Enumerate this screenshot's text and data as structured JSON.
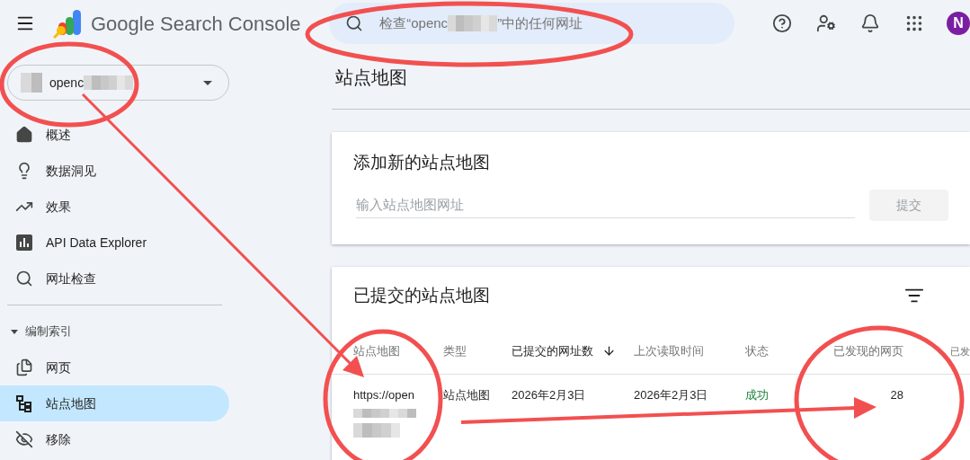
{
  "header": {
    "product": "Google Search Console",
    "search": {
      "placeholder_start": "检查“openc",
      "placeholder_end": "”中的任何网址"
    },
    "avatar": "N"
  },
  "property": {
    "name": "openc"
  },
  "sidebar": {
    "items": [
      {
        "kind": "item",
        "label": "概述",
        "selected": false
      },
      {
        "kind": "item",
        "label": "数据洞见",
        "selected": false
      },
      {
        "kind": "item",
        "label": "效果",
        "selected": false
      },
      {
        "kind": "item",
        "label": "API Data Explorer",
        "selected": false
      },
      {
        "kind": "item",
        "label": "网址检查",
        "selected": false
      },
      {
        "kind": "section",
        "label": "编制索引",
        "expanded": true
      },
      {
        "kind": "item",
        "label": "网页",
        "selected": false
      },
      {
        "kind": "item",
        "label": "站点地图",
        "selected": true
      },
      {
        "kind": "item",
        "label": "移除",
        "selected": false
      }
    ]
  },
  "page_title": "站点地图",
  "add_card": {
    "title": "添加新的站点地图",
    "input": {
      "placeholder": "输入站点地图网址"
    },
    "submit": {
      "label": "提交",
      "disabled": true
    }
  },
  "submitted_card": {
    "title": "已提交的站点地图",
    "table": {
      "columns": [
        {
          "label": "站点地图",
          "sorted": false
        },
        {
          "label": "类型",
          "sorted": false
        },
        {
          "label": "已提交的网址数",
          "sorted": true
        },
        {
          "label": "上次读取时间",
          "sorted": false
        },
        {
          "label": "状态",
          "sorted": false
        },
        {
          "label": "已发现的网页",
          "sorted": false
        },
        {
          "label": "已发",
          "sorted": false
        }
      ],
      "rows": [
        {
          "cells": [
            "https://open",
            "站点地图",
            "2026年2月3日",
            "2026年2月3日",
            {
              "text": "成功",
              "kind": "success"
            },
            "28"
          ]
        }
      ]
    }
  }
}
